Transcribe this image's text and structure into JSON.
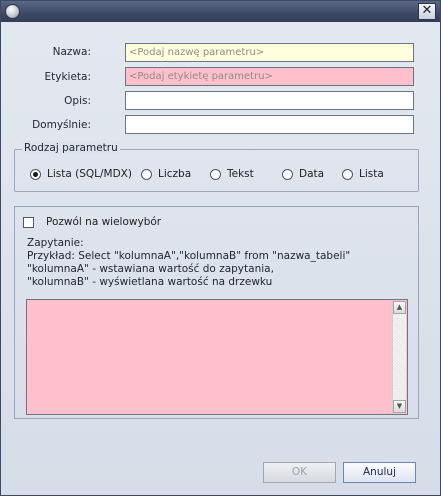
{
  "window": {
    "close_symbol": "✕"
  },
  "form": {
    "name_label": "Nazwa:",
    "name_placeholder": "<Podaj nazwę parametru>",
    "label_label": "Etykieta:",
    "label_placeholder": "<Podaj etykietę parametru>",
    "description_label": "Opis:",
    "description_value": "",
    "default_label": "Domyślnie:",
    "default_value": ""
  },
  "param_type": {
    "title": "Rodzaj parametru",
    "options": [
      "Lista (SQL/MDX)",
      "Liczba",
      "Tekst",
      "Data",
      "Lista"
    ],
    "selected": "Lista (SQL/MDX)"
  },
  "query_section": {
    "multiselect_label": "Pozwól na wielowybór",
    "multiselect_checked": false,
    "line1": "Zapytanie:",
    "line2": "Przykład: Select \"kolumnaA\",\"kolumnaB\" from \"nazwa_tabeli\"",
    "line3": "\"kolumnaA\" - wstawiana wartość do zapytania,",
    "line4": "\"kolumnaB\" - wyświetlana wartość na drzewku",
    "query_value": "",
    "scroll_up": "▲",
    "scroll_down": "▼"
  },
  "buttons": {
    "ok": "OK",
    "cancel": "Anuluj"
  },
  "colors": {
    "required_yellow": "#ffffde",
    "invalid_pink": "#ffbfcb"
  }
}
